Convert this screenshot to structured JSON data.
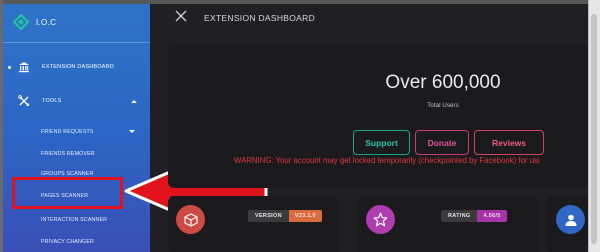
{
  "app": {
    "brand": "I.O.C"
  },
  "sidebar": {
    "dashboard_label": "EXTENSION DASHBOARD",
    "tools_label": "TOOLS",
    "subitems": [
      "FRIEND REQUESTS",
      "FRIENDS REMOVER",
      "GROUPS SCANNER",
      "PAGES SCANNER",
      "INTERACTION SCANNER",
      "PRIVACY CHANGER"
    ]
  },
  "header": {
    "title": "EXTENSION DASHBOARD"
  },
  "stats": {
    "value": "Over 600,000",
    "label": "Total Users"
  },
  "buttons": {
    "support": "Support",
    "donate": "Donate",
    "reviews": "Reviews"
  },
  "warning": "WARNING: Your account may get locked temporarily (checkpointed by Facebook) for usi",
  "cards": {
    "version_label": "VERSION",
    "version_value": "V23.1.0",
    "rating_label": "RATING",
    "rating_value": "4.56/5"
  },
  "colors": {
    "sidebar_top": "#2e73c7",
    "sidebar_bottom": "#3a4fb8",
    "highlight": "#e1121b",
    "support": "#27c4a6",
    "donate": "#e0529a",
    "reviews": "#ec5c78",
    "warning": "#e2363c"
  },
  "icons": [
    "logo-icon",
    "bank-icon",
    "tools-icon",
    "close-icon",
    "box-icon",
    "star-icon",
    "user-icon"
  ]
}
